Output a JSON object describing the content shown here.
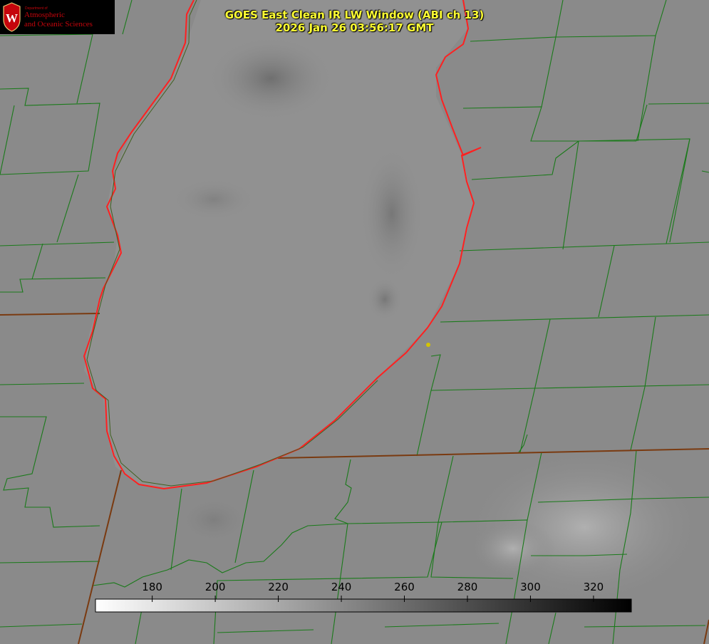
{
  "title": {
    "line1": "GOES East Clean IR LW Window (ABI ch 13)",
    "line2": "2026 Jan 26 03:56:17 GMT"
  },
  "logo": {
    "department": "Department of",
    "line1": "Atmospheric",
    "line2": "and Oceanic Sciences",
    "crest_letter": "W",
    "crest_color": "#c5050c"
  },
  "colorbar": {
    "ticks": [
      "180",
      "200",
      "220",
      "240",
      "260",
      "280",
      "300",
      "320"
    ],
    "tick_values": [
      180,
      200,
      220,
      240,
      260,
      280,
      300,
      320
    ],
    "range": [
      162,
      332
    ],
    "gradient": [
      "#ffffff",
      "#000000"
    ]
  },
  "colors": {
    "land": "#8a8a8a",
    "lake": "#919191",
    "county_lines": "#1a7a1a",
    "state_lines": "#7a3a10",
    "shoreline": "#ff2020",
    "title": "#ffff33",
    "marker": "#d4c400"
  }
}
